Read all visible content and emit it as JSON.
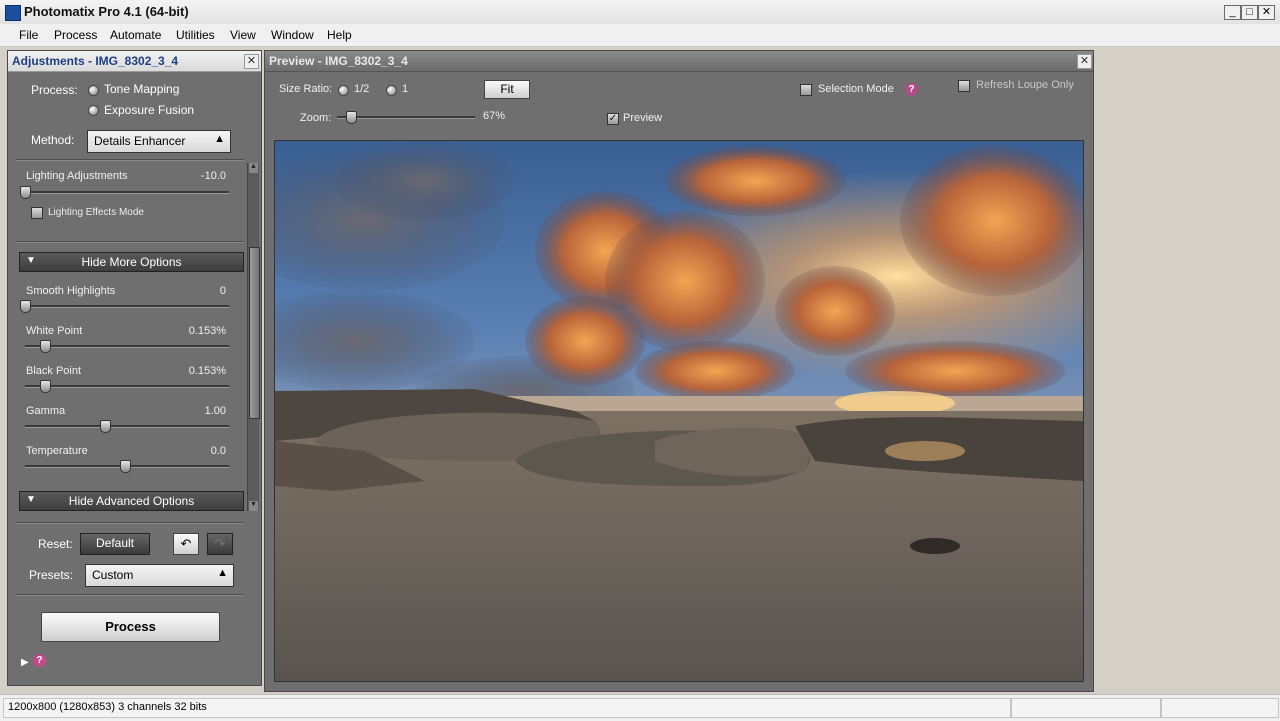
{
  "window": {
    "title": "Photomatix Pro 4.1 (64-bit)",
    "min": "_",
    "max": "□",
    "close": "✕"
  },
  "menu": [
    "File",
    "Process",
    "Automate",
    "Utilities",
    "View",
    "Window",
    "Help"
  ],
  "adjustments": {
    "title": "Adjustments - IMG_8302_3_4",
    "process_label": "Process:",
    "process_options": [
      "Tone Mapping",
      "Exposure Fusion"
    ],
    "method_label": "Method:",
    "method_value": "Details Enhancer",
    "lighting": {
      "label": "Lighting Adjustments",
      "value": "-10.0",
      "level": 0.0
    },
    "lighting_effects_label": "Lighting Effects Mode",
    "hide_more_options": "Hide More Options",
    "sliders": [
      {
        "label": "Smooth Highlights",
        "value": "0",
        "level": 0.0
      },
      {
        "label": "White Point",
        "value": "0.153%",
        "level": 0.1
      },
      {
        "label": "Black Point",
        "value": "0.153%",
        "level": 0.1
      },
      {
        "label": "Gamma",
        "value": "1.00",
        "level": 0.4
      },
      {
        "label": "Temperature",
        "value": "0.0",
        "level": 0.5
      }
    ],
    "hide_advanced_options": "Hide Advanced Options",
    "reset_label": "Reset:",
    "default_button": "Default",
    "presets_label": "Presets:",
    "presets_value": "Custom",
    "process_button": "Process",
    "help_symbol": "?"
  },
  "preview": {
    "title": "Preview - IMG_8302_3_4",
    "size_ratio_label": "Size Ratio:",
    "ratio_options": [
      "1/2",
      "1"
    ],
    "fit_button": "Fit",
    "selection_mode_label": "Selection Mode",
    "help_symbol": "?",
    "refresh_loupe_label": "Refresh Loupe Only",
    "zoom_label": "Zoom:",
    "zoom_value": "67%",
    "zoom_level": 0.1,
    "preview_label": "Preview",
    "preview_checked": true
  },
  "status": {
    "text": "1200x800 (1280x853) 3 channels 32 bits"
  }
}
